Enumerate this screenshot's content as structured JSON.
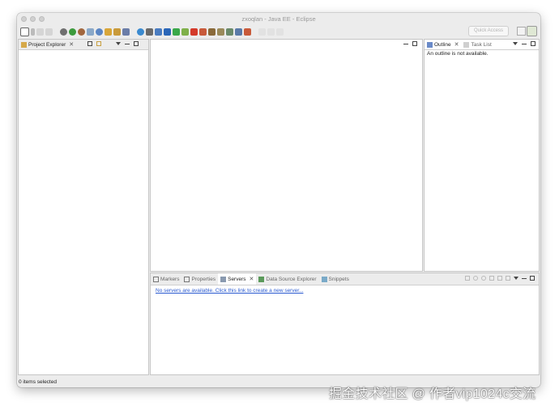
{
  "window": {
    "title": "zxoqlan - Java EE - Eclipse"
  },
  "toolbar": {
    "quick_access_placeholder": "Quick Access",
    "icons": [
      "new-icon",
      "save-icon",
      "save-all-icon",
      "debug-icon",
      "run-icon",
      "run-external-icon",
      "new-server-icon",
      "new-package-icon",
      "open-type-icon",
      "open-task-icon",
      "search-icon",
      "globe-icon",
      "terminal-icon",
      "start-server-icon",
      "stop-server-icon",
      "publish-icon",
      "build-icon",
      "clean-icon"
    ]
  },
  "project_explorer": {
    "title": "Project Explorer"
  },
  "outline": {
    "tab_outline": "Outline",
    "tab_tasklist": "Task List",
    "message": "An outline is not available."
  },
  "bottom": {
    "tabs": [
      "Markers",
      "Properties",
      "Servers",
      "Data Source Explorer",
      "Snippets"
    ],
    "active_tab": "Servers",
    "servers_message": "No servers are available. Click this link to create a new server..."
  },
  "status": {
    "text": "0 items selected"
  },
  "watermark": {
    "text": "掘金技术社区 @ 作者vip1024c交流"
  },
  "colors": {
    "link": "#2a5ad0",
    "chrome": "#ececec"
  }
}
